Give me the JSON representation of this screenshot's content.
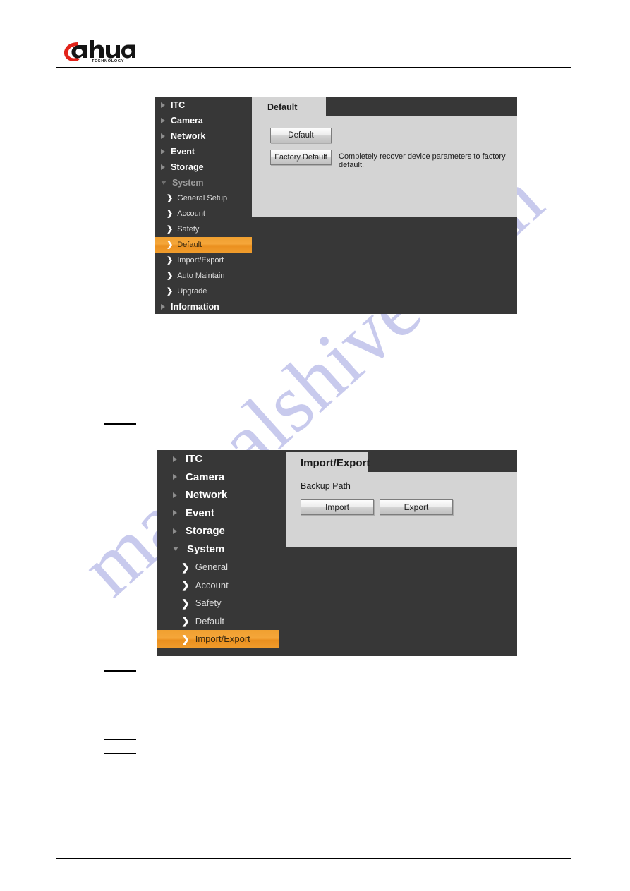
{
  "document": {
    "brand": "dahua",
    "brand_tagline": "TECHNOLOGY"
  },
  "panel_default": {
    "tab_label": "Default",
    "nav_top": [
      {
        "label": "ITC",
        "icon": "triangle-right-icon",
        "expanded": false
      },
      {
        "label": "Camera",
        "icon": "triangle-right-icon",
        "expanded": false
      },
      {
        "label": "Network",
        "icon": "triangle-right-icon",
        "expanded": false
      },
      {
        "label": "Event",
        "icon": "triangle-right-icon",
        "expanded": false
      },
      {
        "label": "Storage",
        "icon": "triangle-right-icon",
        "expanded": false
      },
      {
        "label": "System",
        "icon": "triangle-down-icon",
        "expanded": true
      }
    ],
    "nav_sub": [
      {
        "label": "General Setup",
        "icon": "chevron-right-icon",
        "active": false
      },
      {
        "label": "Account",
        "icon": "chevron-right-icon",
        "active": false
      },
      {
        "label": "Safety",
        "icon": "chevron-right-icon",
        "active": false
      },
      {
        "label": "Default",
        "icon": "chevron-right-icon",
        "active": true
      },
      {
        "label": "Import/Export",
        "icon": "chevron-right-icon",
        "active": false
      },
      {
        "label": "Auto Maintain",
        "icon": "chevron-right-icon",
        "active": false
      },
      {
        "label": "Upgrade",
        "icon": "chevron-right-icon",
        "active": false
      }
    ],
    "nav_bottom": {
      "label": "Information",
      "icon": "triangle-right-icon"
    },
    "default_button": "Default",
    "factory_default_button": "Factory Default",
    "factory_default_description": "Completely recover device parameters to factory default."
  },
  "panel_import_export": {
    "tab_label": "Import/Export",
    "nav_top": [
      {
        "label": "ITC",
        "icon": "triangle-right-icon",
        "expanded": false
      },
      {
        "label": "Camera",
        "icon": "triangle-right-icon",
        "expanded": false
      },
      {
        "label": "Network",
        "icon": "triangle-right-icon",
        "expanded": false
      },
      {
        "label": "Event",
        "icon": "triangle-right-icon",
        "expanded": false
      },
      {
        "label": "Storage",
        "icon": "triangle-right-icon",
        "expanded": false
      },
      {
        "label": "System",
        "icon": "triangle-down-icon",
        "expanded": true
      }
    ],
    "nav_sub": [
      {
        "label": "General",
        "icon": "chevron-right-icon",
        "active": false
      },
      {
        "label": "Account",
        "icon": "chevron-right-icon",
        "active": false
      },
      {
        "label": "Safety",
        "icon": "chevron-right-icon",
        "active": false
      },
      {
        "label": "Default",
        "icon": "chevron-right-icon",
        "active": false
      },
      {
        "label": "Import/Export",
        "icon": "chevron-right-icon",
        "active": true
      }
    ],
    "backup_path_label": "Backup Path",
    "import_button": "Import",
    "export_button": "Export"
  },
  "watermark": {
    "text": "manualshive.com",
    "color": "#9b9ede"
  },
  "colors": {
    "panel_background": "#373737",
    "content_background": "#d4d4d4",
    "accent_orange": "#f0a030",
    "brand_red": "#e2231a",
    "rule_black": "#000000"
  }
}
